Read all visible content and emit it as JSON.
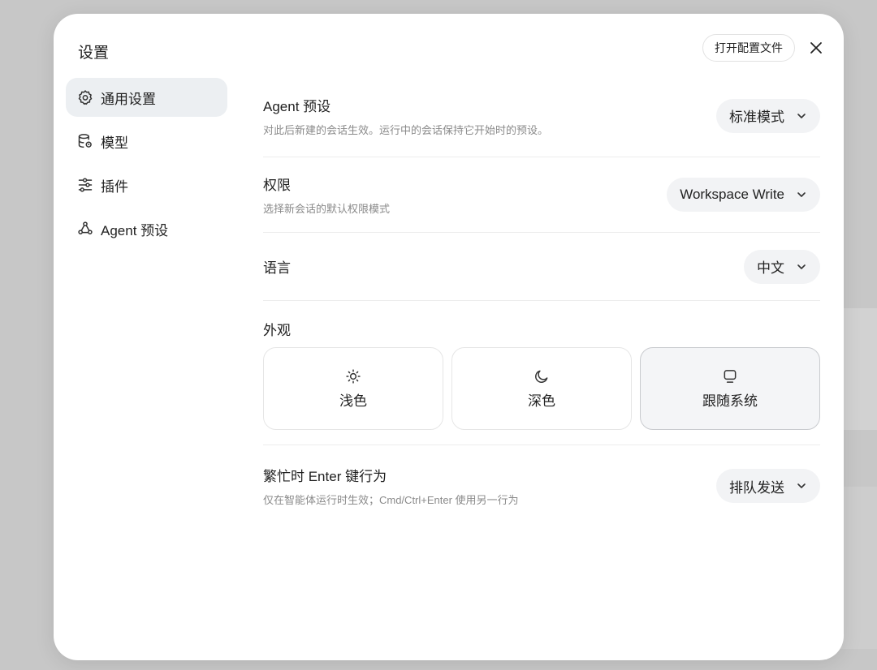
{
  "modal": {
    "title": "设置",
    "open_config_label": "打开配置文件"
  },
  "sidebar": {
    "items": [
      {
        "label": "通用设置",
        "icon": "gear-icon",
        "active": true
      },
      {
        "label": "模型",
        "icon": "database-icon",
        "active": false
      },
      {
        "label": "插件",
        "icon": "sliders-icon",
        "active": false
      },
      {
        "label": "Agent 预设",
        "icon": "network-icon",
        "active": false
      }
    ]
  },
  "settings": {
    "agent_preset": {
      "title": "Agent 预设",
      "desc": "对此后新建的会话生效。运行中的会话保持它开始时的预设。",
      "value": "标准模式"
    },
    "permissions": {
      "title": "权限",
      "desc": "选择新会话的默认权限模式",
      "value": "Workspace Write"
    },
    "language": {
      "title": "语言",
      "value": "中文"
    },
    "appearance": {
      "title": "外观",
      "options": [
        {
          "label": "浅色",
          "icon": "sun-icon",
          "selected": false
        },
        {
          "label": "深色",
          "icon": "moon-icon",
          "selected": false
        },
        {
          "label": "跟随系统",
          "icon": "monitor-icon",
          "selected": true
        }
      ]
    },
    "busy_enter": {
      "title": "繁忙时 Enter 键行为",
      "desc": "仅在智能体运行时生效；Cmd/Ctrl+Enter 使用另一行为",
      "value": "排队发送"
    }
  }
}
